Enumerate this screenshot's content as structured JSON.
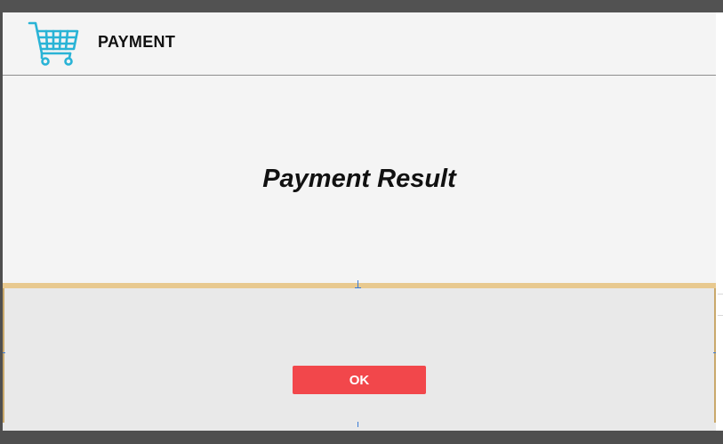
{
  "header": {
    "title": "PAYMENT",
    "icon": "shopping-cart-icon",
    "icon_color": "#29b3d6"
  },
  "main": {
    "heading": "Payment Result"
  },
  "footer": {
    "ok_label": "OK",
    "ok_color": "#f2474b"
  }
}
